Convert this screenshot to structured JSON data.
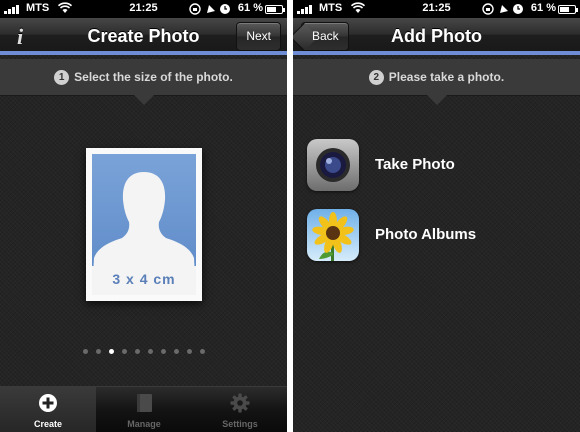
{
  "status_bar": {
    "carrier": "MTS",
    "time": "21:25",
    "battery": "61 %",
    "battery_level": 0.61
  },
  "left_screen": {
    "title": "Create Photo",
    "next_label": "Next",
    "step_number": "1",
    "instruction": "Select the size of the photo.",
    "photo_size_label": "3 x 4 cm",
    "page_dots": {
      "count": 10,
      "active_index": 2
    },
    "tabs": [
      {
        "label": "Create",
        "icon": "plus-circle-icon",
        "selected": true
      },
      {
        "label": "Manage",
        "icon": "book-icon",
        "selected": false
      },
      {
        "label": "Settings",
        "icon": "gear-icon",
        "selected": false
      }
    ]
  },
  "right_screen": {
    "title": "Add Photo",
    "back_label": "Back",
    "step_number": "2",
    "instruction": "Please take a photo.",
    "actions": [
      {
        "label": "Take Photo",
        "icon": "camera-icon"
      },
      {
        "label": "Photo Albums",
        "icon": "sunflower-icon"
      }
    ]
  },
  "colors": {
    "nav_accent": "#6e8dd4",
    "background": "#242424",
    "photo_blue": "#6b95cf"
  }
}
